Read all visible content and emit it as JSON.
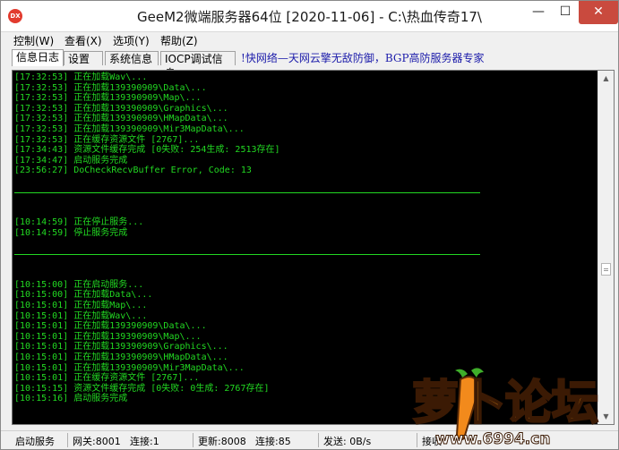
{
  "window": {
    "app_icon": "DX",
    "title": "GeeM2微端服务器64位 [2020-11-06] - C:\\热血传奇17\\",
    "buttons": {
      "minimize": "—",
      "maximize": "☐",
      "close": "✕"
    }
  },
  "menu": [
    "控制(W)",
    "查看(X)",
    "选项(Y)",
    "帮助(Z)"
  ],
  "tabs": [
    "信息日志",
    "设置",
    "系统信息",
    "IOCP调试信息"
  ],
  "active_tab": "信息日志",
  "banner": "!快网络—天网云擎无敌防御，BGP高防服务器专家",
  "log": [
    "[17:32:53] 正在加载Wav\\...",
    "[17:32:53] 正在加载139390909\\Data\\...",
    "[17:32:53] 正在加载139390909\\Map\\...",
    "[17:32:53] 正在加载139390909\\Graphics\\...",
    "[17:32:53] 正在加载139390909\\HMapData\\...",
    "[17:32:53] 正在加载139390909\\Mir3MapData\\...",
    "[17:32:53] 正在缓存资源文件 [2767]...",
    "[17:34:43] 资源文件缓存完成 [0失败: 254生成: 2513存在]",
    "[17:34:47] 启动服务完成",
    "[23:56:27] DoCheckRecvBuffer Error, Code: 13",
    "",
    "---",
    "",
    "",
    "[10:14:59] 正在停止服务...",
    "[10:14:59] 停止服务完成",
    "",
    "---",
    "",
    "",
    "[10:15:00] 正在启动服务...",
    "[10:15:00] 正在加载Data\\...",
    "[10:15:01] 正在加载Map\\...",
    "[10:15:01] 正在加载Wav\\...",
    "[10:15:01] 正在加载139390909\\Data\\...",
    "[10:15:01] 正在加载139390909\\Map\\...",
    "[10:15:01] 正在加载139390909\\Graphics\\...",
    "[10:15:01] 正在加载139390909\\HMapData\\...",
    "[10:15:01] 正在加载139390909\\Mir3MapData\\...",
    "[10:15:01] 正在缓存资源文件 [2767]...",
    "[10:15:15] 资源文件缓存完成 [0失败: 0生成: 2767存在]",
    "[10:15:16] 启动服务完成"
  ],
  "scrollbar": {
    "up_arrow": "▲",
    "down_arrow": "▼"
  },
  "status": [
    "启动服务",
    "网关:8001",
    "连接:1",
    "更新:8008",
    "连接:85",
    "发送: 0B/s",
    "接收"
  ],
  "watermark": {
    "main": "萝卜论坛",
    "url": "www.6994.cn"
  },
  "colors": {
    "log_text": "#22d822",
    "log_background": "#000000",
    "close_button": "#c94a3e",
    "banner_text": "#1b1baa",
    "watermark_orange": "#f39a1e"
  }
}
